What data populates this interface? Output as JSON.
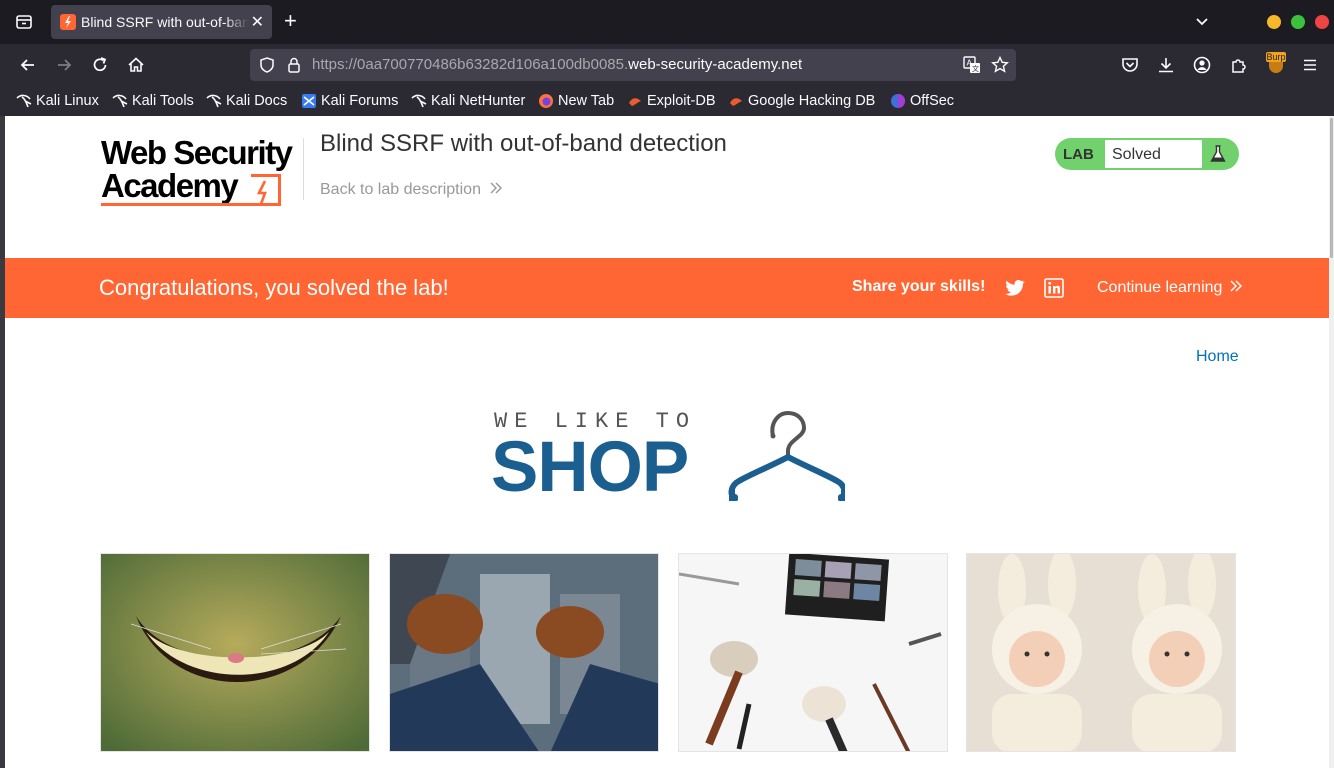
{
  "browser": {
    "tab_title": "Blind SSRF with out-of-band detection",
    "url_prefix": "https://0aa700770486b63282d106a100db0085.",
    "url_host": "web-security-academy.net",
    "bookmarks": [
      "Kali Linux",
      "Kali Tools",
      "Kali Docs",
      "Kali Forums",
      "Kali NetHunter",
      "New Tab",
      "Exploit-DB",
      "Google Hacking DB",
      "OffSec"
    ],
    "extension_label": "Burp"
  },
  "header": {
    "logo_line1": "Web Security",
    "logo_line2": "Academy",
    "lab_title": "Blind SSRF with out-of-band detection",
    "back_link": "Back to lab description",
    "lab_badge": "LAB",
    "lab_status": "Solved"
  },
  "banner": {
    "message": "Congratulations, you solved the lab!",
    "share_label": "Share your skills!",
    "continue_label": "Continue learning"
  },
  "nav": {
    "home_link": "Home"
  },
  "shop_logo": {
    "small_text": "WE LIKE TO",
    "big_text": "SHOP"
  },
  "products": [
    {
      "image": "cheshire-cat-grin"
    },
    {
      "image": "shoes-over-city"
    },
    {
      "image": "makeup-brushes-palette"
    },
    {
      "image": "babies-in-bunny-hoods"
    }
  ],
  "colors": {
    "accent": "#ff6633",
    "lab_solved": "#70d16d",
    "shop_blue": "#1a5f8f",
    "link": "#0071bc"
  }
}
